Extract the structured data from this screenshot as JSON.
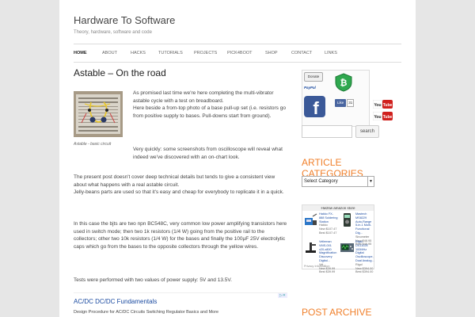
{
  "site": {
    "title": "Hardware To Software",
    "description": "Theory, hardware, software and code"
  },
  "nav": {
    "items": [
      "HOME",
      "ABOUT",
      "HACKS",
      "TUTORIALS",
      "PROJECTS",
      "PICK4BOOT",
      "SHOP",
      "CONTACT",
      "LINKS"
    ],
    "active": "HOME"
  },
  "post": {
    "title": "Astable – On the road",
    "figure_caption": "Astable - basic circuit",
    "p1": "As promised last time we're here completing the multi-vibrator astable cycle with a test on breadboard.\nHere beside a from-top photo of a base pull-up set (i.e. resistors go from positive supply to bases. Pull-downs start from ground).",
    "p2": "Very quickly: some screenshots from oscilloscope will reveal what indeed we've discovered with an on-chart look.",
    "p3": "The present post doesn't cover deep technical details but tends to give a consistent view about what happens with a real astable circuit.\nJelly-beans parts are used so that it's easy and cheap for everybody to replicate it in a quick.",
    "p4": "In this case the bjts are two npn BC548C, very common low power amplifying transistors here used in switch mode; then two 1k resistors (1/4 W) going from the positive rail to the collectors; other two 10k resistors (1/4 W) for the bases and finally the 100µF 25V electrolytic caps which go from the bases to the opposite collectors through the yellow wires.",
    "p5": "Tests were performed with two values of power supply: 5V and 13.5V."
  },
  "ad": {
    "title": "AC/DC DC/DC Fundamentals",
    "url": "micro.rohm.com",
    "desc": "Design Procedure for AC/DC Circuits Switching Regulator Basics and More"
  },
  "sidebar": {
    "donate_label": "Donate",
    "paypal_label": "PayPal",
    "like_label": "Like",
    "like_count": "31",
    "youtube_label": "You Tube",
    "search_placeholder": "",
    "search_button": "search",
    "categories_title": "ARTICLE CATEGORIES",
    "categories_select": "Select Category",
    "amazon_header": "Hw2sw amazon store",
    "amazon_items": [
      {
        "name": "Hakko FX-888 Soldering Station",
        "seller": "Hakko",
        "list": "New $107.47",
        "best": "Best $107.47"
      },
      {
        "name": "Mastech MS8229 Auto-Range 5-in-1 Multi-Functional Dig...",
        "seller": "Sinometer",
        "list": "New $48.95",
        "best": "Best $48.95"
      },
      {
        "name": "Velleman VMS-001 x20-x800 Magnification Discovery Digital...",
        "seller": "Vel...",
        "list": "New $39.99",
        "best": "Best $39.99"
      },
      {
        "name": "Rigol DS1102E 100MHz Digital Oscilloscope, Dual Analog...",
        "seller": "Rigol",
        "list": "New $394.00",
        "best": "Best $394.00"
      }
    ],
    "amazon_footer": "Privacy Information",
    "archive_title": "POST ARCHIVE"
  },
  "colors": {
    "accent_orange": "#f07f2a",
    "link_blue": "#1a4aa0",
    "background": "#e6e6e6"
  }
}
